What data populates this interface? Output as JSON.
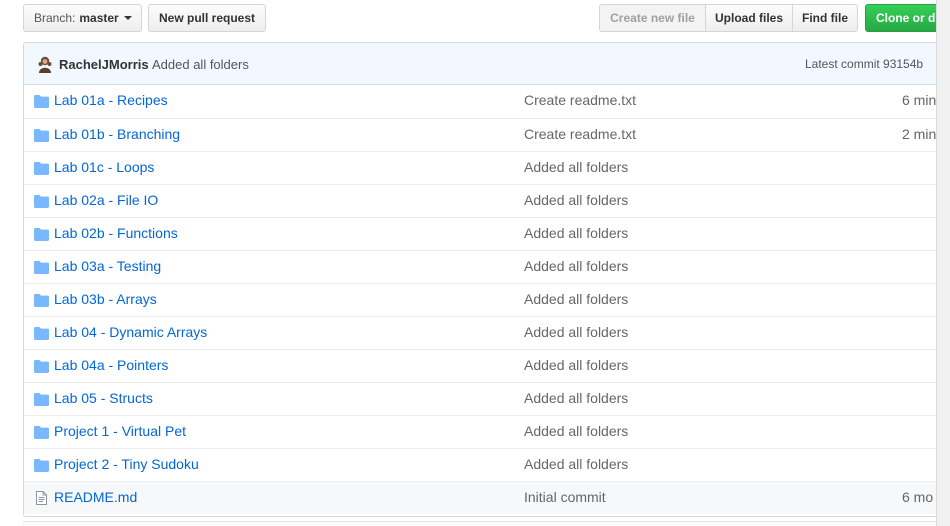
{
  "toolbar": {
    "branch_prefix": "Branch:",
    "branch_value": "master",
    "new_pull_request": "New pull request",
    "create_new_file": "Create new file",
    "upload_files": "Upload files",
    "find_file": "Find file",
    "clone": "Clone or d"
  },
  "commit": {
    "author": "RachelJMorris",
    "message": "Added all folders",
    "latest": "Latest commit 93154b"
  },
  "files": [
    {
      "type": "folder",
      "name": "Lab 01a - Recipes",
      "message": "Create readme.txt",
      "age": "6 min"
    },
    {
      "type": "folder",
      "name": "Lab 01b - Branching",
      "message": "Create readme.txt",
      "age": "2 min"
    },
    {
      "type": "folder",
      "name": "Lab 01c - Loops",
      "message": "Added all folders",
      "age": ""
    },
    {
      "type": "folder",
      "name": "Lab 02a - File IO",
      "message": "Added all folders",
      "age": ""
    },
    {
      "type": "folder",
      "name": "Lab 02b - Functions",
      "message": "Added all folders",
      "age": ""
    },
    {
      "type": "folder",
      "name": "Lab 03a - Testing",
      "message": "Added all folders",
      "age": ""
    },
    {
      "type": "folder",
      "name": "Lab 03b - Arrays",
      "message": "Added all folders",
      "age": ""
    },
    {
      "type": "folder",
      "name": "Lab 04 - Dynamic Arrays",
      "message": "Added all folders",
      "age": ""
    },
    {
      "type": "folder",
      "name": "Lab 04a - Pointers",
      "message": "Added all folders",
      "age": ""
    },
    {
      "type": "folder",
      "name": "Lab 05 - Structs",
      "message": "Added all folders",
      "age": ""
    },
    {
      "type": "folder",
      "name": "Project 1 - Virtual Pet",
      "message": "Added all folders",
      "age": ""
    },
    {
      "type": "folder",
      "name": "Project 2 - Tiny Sudoku",
      "message": "Added all folders",
      "age": ""
    },
    {
      "type": "file",
      "name": "README.md",
      "message": "Initial commit",
      "age": "6 mo"
    }
  ],
  "colors": {
    "link": "#0366d6",
    "folder_icon": "#79b8ff",
    "commit_bar_bg": "#f1f8ff",
    "clone_button": "#28a745"
  },
  "icons": {
    "folder": "folder-icon",
    "file": "file-text-icon",
    "caret": "caret-down-icon",
    "avatar": "avatar"
  }
}
